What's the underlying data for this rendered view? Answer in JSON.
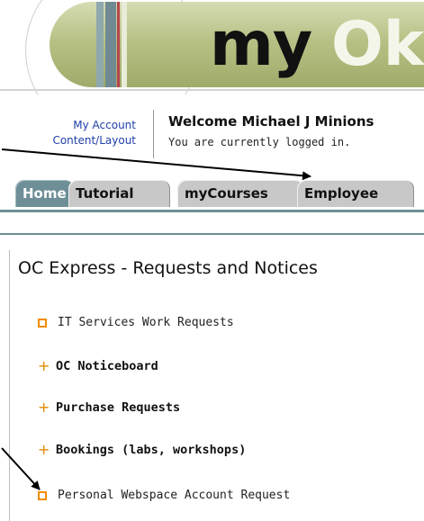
{
  "banner": {
    "word_my": "my",
    "word_ok": "Ok"
  },
  "account": {
    "links": [
      "My Account",
      "Content/Layout"
    ],
    "welcome": "Welcome Michael J Minions",
    "status": "You are currently logged in."
  },
  "tabs": [
    {
      "label": "Home",
      "active": true
    },
    {
      "label": "Tutorial",
      "active": false
    },
    {
      "label": "myCourses",
      "active": false
    },
    {
      "label": "Employee",
      "active": false
    }
  ],
  "requests_panel": {
    "title": "OC Express - Requests and Notices",
    "items": [
      {
        "label": "IT Services Work Requests",
        "bullet": "square-icon",
        "bold": false
      },
      {
        "label": "OC Noticeboard",
        "bullet": "plus-icon",
        "bold": true
      },
      {
        "label": "Purchase Requests",
        "bullet": "plus-icon",
        "bold": true
      },
      {
        "label": "Bookings (labs, workshops)",
        "bullet": "plus-icon",
        "bold": true
      },
      {
        "label": "Personal Webspace Account Request",
        "bullet": "square-icon",
        "bold": false
      }
    ]
  },
  "colors": {
    "tab_active": "#6e8f97",
    "tab_inactive": "#c8c8c8",
    "link": "#1f3fa8",
    "bullet": "#f28c00",
    "banner_green": "#b7c185"
  }
}
